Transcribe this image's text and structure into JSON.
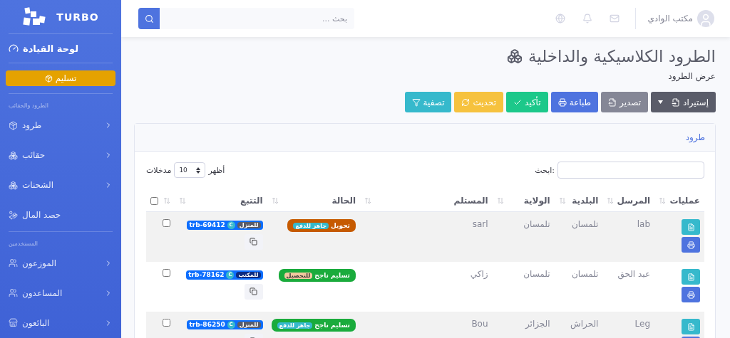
{
  "sidebar": {
    "brand": "TURBO",
    "dashboard": "لوحة القيادة",
    "cta": "تسليم",
    "sections": [
      {
        "heading": "الطرود والحقائب",
        "items": [
          {
            "label": "طرود",
            "has_children": true
          },
          {
            "label": "حقائب",
            "has_children": true
          },
          {
            "label": "الشحنات",
            "has_children": true
          },
          {
            "label": "حصد المال",
            "has_children": false
          }
        ]
      },
      {
        "heading": "المستخدمين",
        "items": [
          {
            "label": "الموزعون",
            "has_children": true
          },
          {
            "label": "المساعدون",
            "has_children": true
          },
          {
            "label": "البائعون",
            "has_children": true
          }
        ]
      }
    ]
  },
  "topbar": {
    "search": {
      "placeholder": "بحث ..."
    },
    "user": "مكتب الوادي"
  },
  "page": {
    "title": "الطرود الكلاسيكية والداخلية",
    "subtitle": "عرض الطرود"
  },
  "actions": [
    {
      "label": "إستيراد",
      "kind": "import",
      "dropdown": true
    },
    {
      "label": "تصدير",
      "kind": "export",
      "dropdown": false
    },
    {
      "label": "طباعة",
      "kind": "print",
      "dropdown": false
    },
    {
      "label": "تأكيد",
      "kind": "confirm",
      "dropdown": false
    },
    {
      "label": "تحديث",
      "kind": "refresh",
      "dropdown": false
    },
    {
      "label": "تصفية",
      "kind": "filter",
      "dropdown": false
    }
  ],
  "card": {
    "title": "طرود",
    "search_label": ":ابحث",
    "length": {
      "before": "أظهر",
      "value": "10",
      "after": "مدخلات"
    }
  },
  "columns": [
    {
      "label": "عمليات"
    },
    {
      "label": "المرسل"
    },
    {
      "label": "البلدية"
    },
    {
      "label": "الولاية"
    },
    {
      "label": "المستلم"
    },
    {
      "label": "الحالة"
    },
    {
      "label": "التتبع"
    }
  ],
  "select_all": {
    "checked": false
  },
  "rows": [
    {
      "checked": false,
      "tracking": "trb-69412",
      "carrier": "C",
      "delivery": {
        "label": "للمنزل",
        "color": "#5a5c69"
      },
      "status": {
        "label": "تحويل",
        "color": "#c65a00"
      },
      "payment": {
        "label": "جاهز للدفع",
        "color": "#36b9cc"
      },
      "receiver": "sarl",
      "wilaya": "تلمسان",
      "commune": "تلمسان",
      "sender": "lab"
    },
    {
      "checked": false,
      "tracking": "trb-78162",
      "carrier": "C",
      "delivery": {
        "label": "للمكتب",
        "color": "#0b2a80"
      },
      "status": {
        "label": "تسليم ناجح",
        "color": "#1aab3c"
      },
      "payment": {
        "label": "للتحصيل",
        "color": "#f3c9a0"
      },
      "receiver": "زاكي",
      "wilaya": "تلمسان",
      "commune": "تلمسان",
      "sender": "عبد الحق"
    },
    {
      "checked": false,
      "tracking": "trb-86250",
      "carrier": "C",
      "delivery": {
        "label": "للمنزل",
        "color": "#5a5c69"
      },
      "status": {
        "label": "تسليم ناجح",
        "color": "#1aab3c"
      },
      "payment": {
        "label": "جاهز للدفع",
        "color": "#36b9cc"
      },
      "receiver": "Bou",
      "wilaya": "الجزائر",
      "commune": "الحراش",
      "sender": "Leg"
    }
  ]
}
